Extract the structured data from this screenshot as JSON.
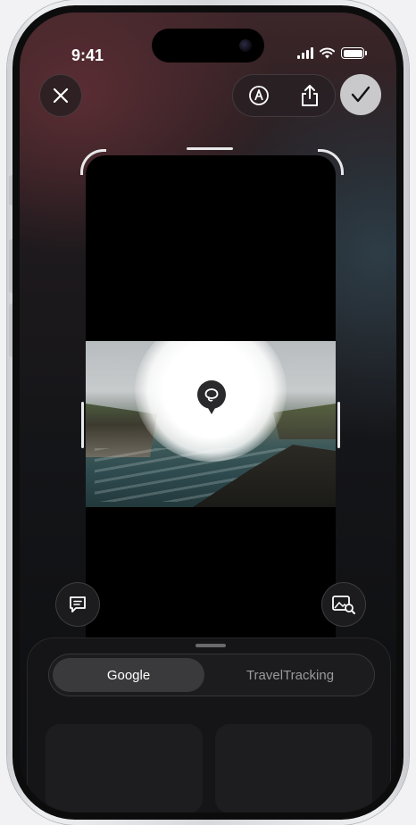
{
  "status_bar": {
    "time": "9:41"
  },
  "toolbar": {
    "close_icon": "close-icon",
    "markup_icon": "markup-pen-icon",
    "share_icon": "share-icon",
    "confirm_icon": "checkmark-icon"
  },
  "overlay": {
    "lens_icon": "visual-lookup-icon",
    "chat_icon": "chat-bubble-icon",
    "image_search_icon": "image-search-icon"
  },
  "sheet": {
    "tabs": [
      {
        "label": "Google",
        "selected": true
      },
      {
        "label": "TravelTracking",
        "selected": false
      }
    ]
  },
  "colors": {
    "accent": "#c9c9cb",
    "sheet_bg": "#161618",
    "active_tab": "#3a3a3c"
  }
}
